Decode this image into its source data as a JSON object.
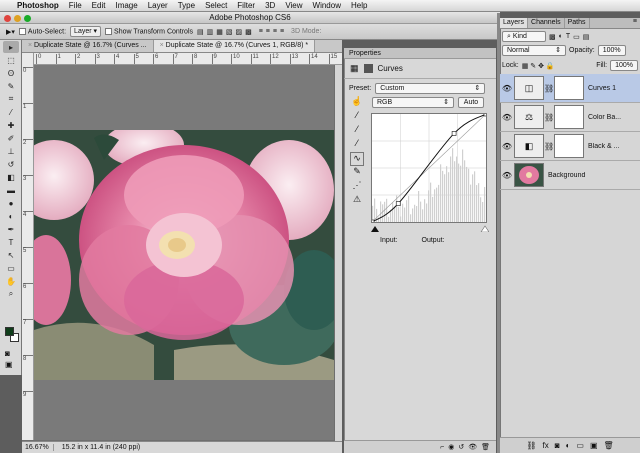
{
  "menubar": {
    "apple": "",
    "app": "Photoshop",
    "items": [
      "File",
      "Edit",
      "Image",
      "Layer",
      "Type",
      "Select",
      "Filter",
      "3D",
      "View",
      "Window",
      "Help"
    ]
  },
  "window": {
    "title": "Adobe Photoshop CS6"
  },
  "options": {
    "auto_select_label": "Auto-Select:",
    "auto_select_value": "Layer",
    "transform_label": "Show Transform Controls",
    "mode_3d": "3D Mode:"
  },
  "tabs": [
    {
      "label": "Duplicate State @ 16.7% (Curves ...",
      "active": false
    },
    {
      "label": "Duplicate State @ 16.7% (Curves 1, RGB/8) *",
      "active": true
    }
  ],
  "ruler_h": [
    "0",
    "1",
    "2",
    "3",
    "4",
    "5",
    "6",
    "7",
    "8",
    "9",
    "10",
    "11",
    "12",
    "13",
    "14",
    "15"
  ],
  "ruler_v": [
    "0",
    "1",
    "2",
    "3",
    "4",
    "5",
    "6",
    "7",
    "8",
    "9"
  ],
  "status": {
    "zoom": "16.67%",
    "doc_info": "15.2 in x 11.4 in (240 ppi)"
  },
  "properties": {
    "tab": "Properties",
    "title": "Curves",
    "preset_label": "Preset:",
    "preset_value": "Custom",
    "channel": "RGB",
    "auto_button": "Auto",
    "input_label": "Input:",
    "output_label": "Output:",
    "curve_points": [
      [
        0.0,
        0.0
      ],
      [
        0.23,
        0.17
      ],
      [
        0.72,
        0.82
      ],
      [
        1.0,
        1.0
      ]
    ]
  },
  "layers": {
    "tabs": [
      "Layers",
      "Channels",
      "Paths"
    ],
    "kind": "Kind",
    "blend": "Normal",
    "opacity_label": "Opacity:",
    "opacity": "100%",
    "lock_label": "Lock:",
    "fill_label": "Fill:",
    "fill": "100%",
    "rows": [
      {
        "name": "Curves 1",
        "selected": true,
        "icon": "curves-icon"
      },
      {
        "name": "Color Ba...",
        "selected": false,
        "icon": "balance-icon"
      },
      {
        "name": "Black & ...",
        "selected": false,
        "icon": "bw-icon"
      },
      {
        "name": "Background",
        "selected": false,
        "icon": "image-thumb"
      }
    ]
  },
  "colors": {
    "foreground": "#0f3d1a",
    "background": "#ffffff",
    "selection": "#b9c9e6"
  }
}
